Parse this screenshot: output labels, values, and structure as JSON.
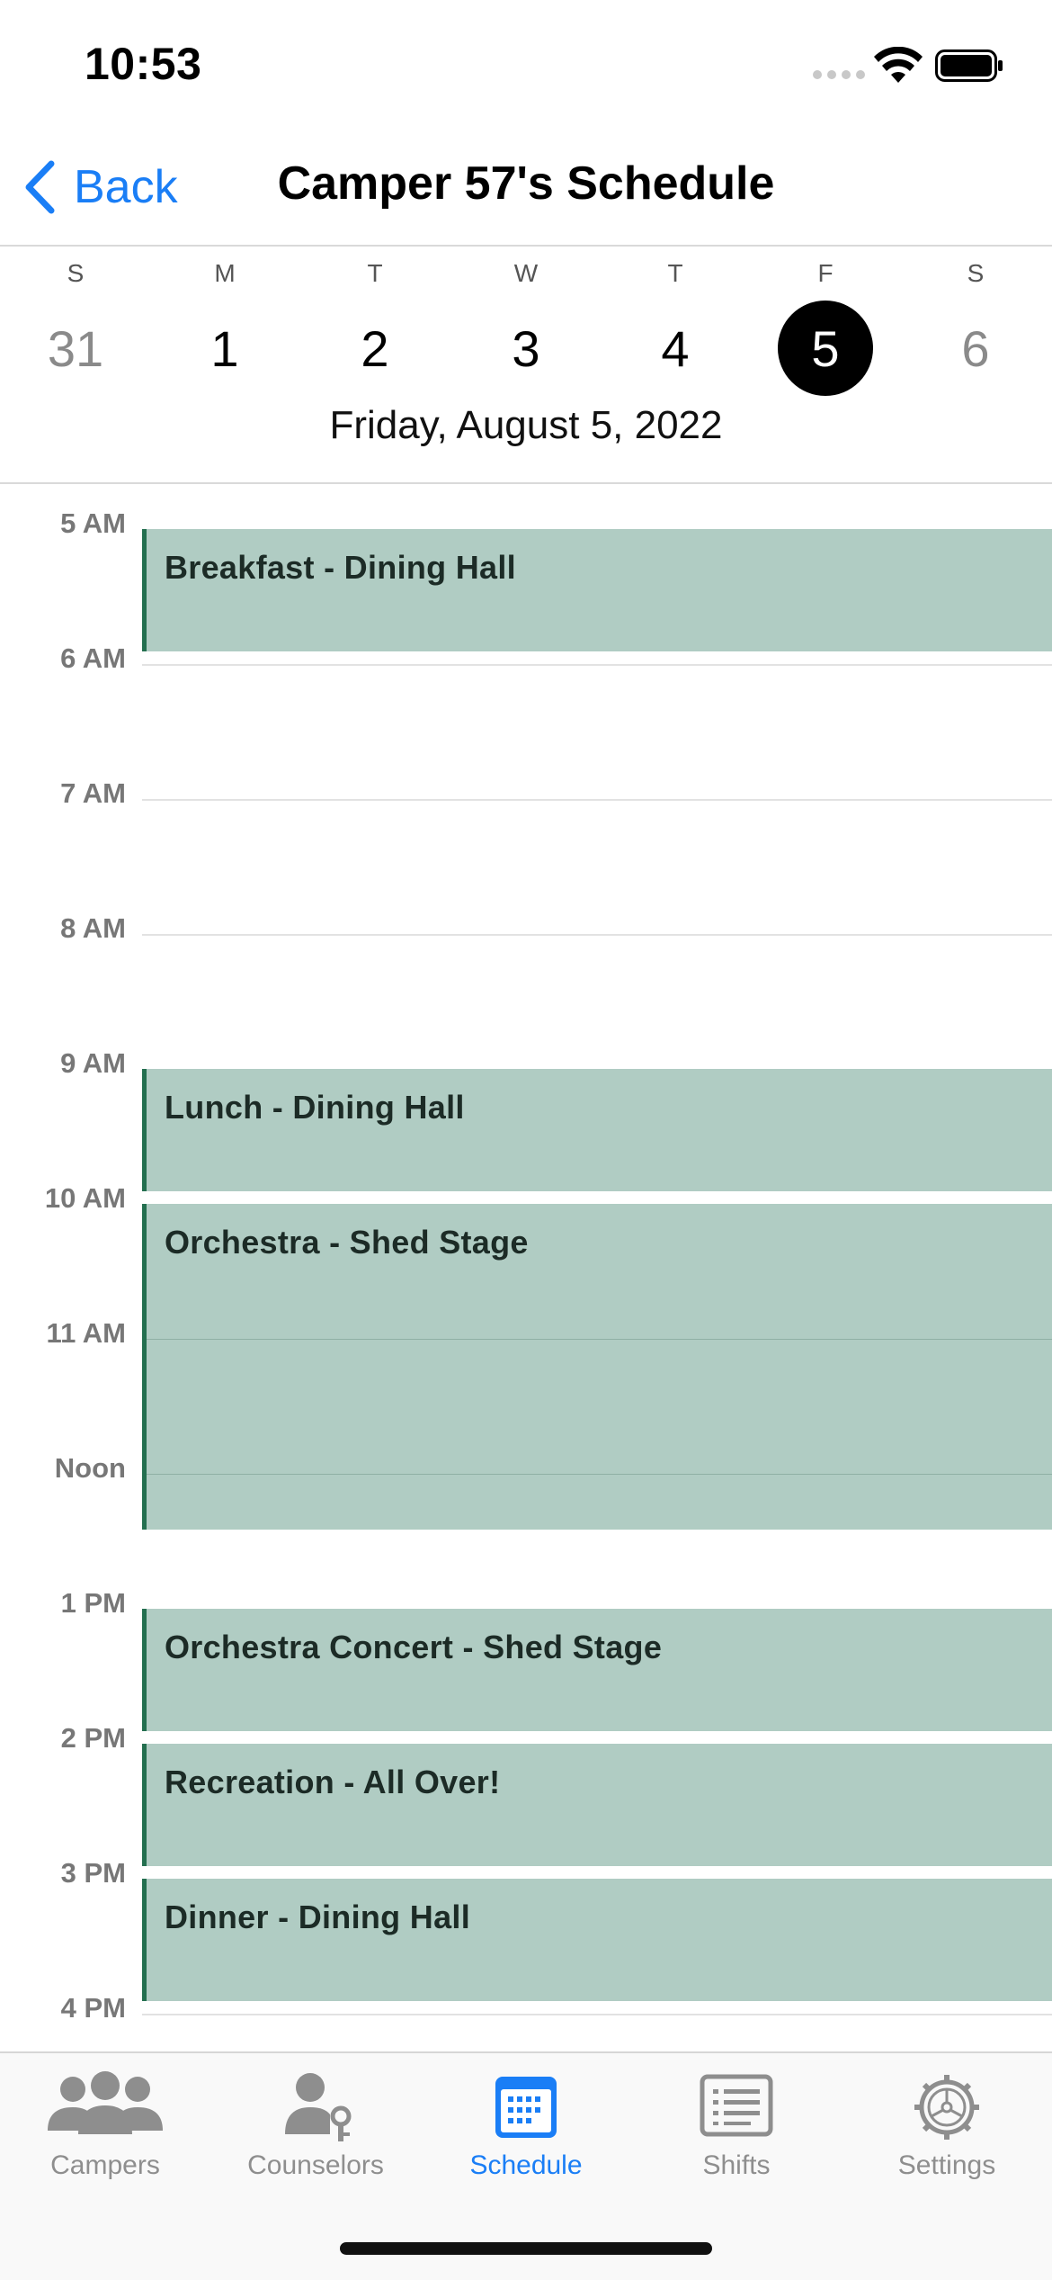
{
  "status_bar": {
    "time": "10:53"
  },
  "nav": {
    "back_label": "Back",
    "title": "Camper 57's Schedule"
  },
  "week": {
    "days": [
      {
        "letter": "S",
        "number": "31"
      },
      {
        "letter": "M",
        "number": "1"
      },
      {
        "letter": "T",
        "number": "2"
      },
      {
        "letter": "W",
        "number": "3"
      },
      {
        "letter": "T",
        "number": "4"
      },
      {
        "letter": "F",
        "number": "5"
      },
      {
        "letter": "S",
        "number": "6"
      }
    ],
    "selected_label": "Friday, August 5, 2022"
  },
  "timeline": {
    "hours": [
      "5 AM",
      "6 AM",
      "7 AM",
      "8 AM",
      "9 AM",
      "10 AM",
      "11 AM",
      "Noon",
      "1 PM",
      "2 PM",
      "3 PM",
      "4 PM"
    ],
    "events": [
      {
        "title": "Breakfast - Dining Hall"
      },
      {
        "title": "Lunch - Dining Hall"
      },
      {
        "title": "Orchestra - Shed Stage"
      },
      {
        "title": "Orchestra Concert - Shed Stage"
      },
      {
        "title": "Recreation - All Over!"
      },
      {
        "title": "Dinner - Dining Hall"
      }
    ]
  },
  "tabs": [
    {
      "label": "Campers",
      "icon": "people-icon"
    },
    {
      "label": "Counselors",
      "icon": "person-key-icon"
    },
    {
      "label": "Schedule",
      "icon": "calendar-icon"
    },
    {
      "label": "Shifts",
      "icon": "list-icon"
    },
    {
      "label": "Settings",
      "icon": "gear-icon"
    }
  ],
  "colors": {
    "accent": "#1a7ef6",
    "event_fill": "#b0ccc3",
    "event_border": "#236f4f",
    "inactive_tab": "#8e8e8e"
  }
}
